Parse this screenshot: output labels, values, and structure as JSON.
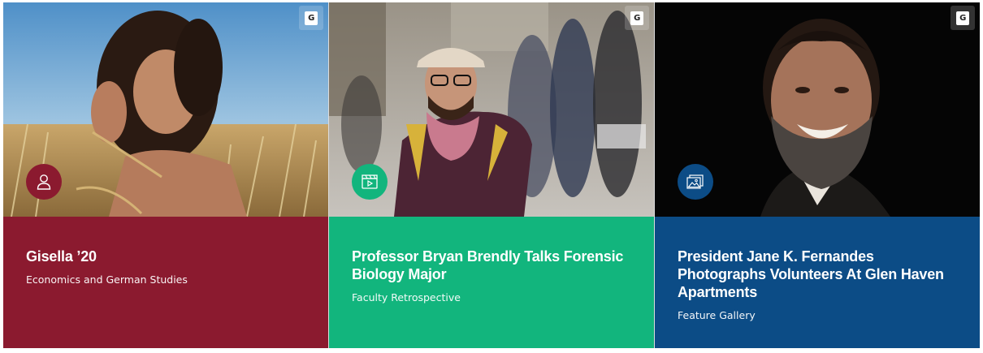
{
  "colors": {
    "card1": "#8b1a2f",
    "card2": "#12b57d",
    "card3": "#0c4c86"
  },
  "badge_label": "G",
  "cards": [
    {
      "title": "Gisella ’20",
      "subtitle": "Economics and German Studies",
      "icon": "person-icon"
    },
    {
      "title": "Professor Bryan Brendly Talks Forensic Biology Major",
      "subtitle": "Faculty Retrospective",
      "icon": "video-clapper-icon"
    },
    {
      "title": "President Jane K. Fernandes Photographs Volunteers At Glen Haven Apartments",
      "subtitle": "Feature Gallery",
      "icon": "photo-gallery-icon"
    }
  ]
}
